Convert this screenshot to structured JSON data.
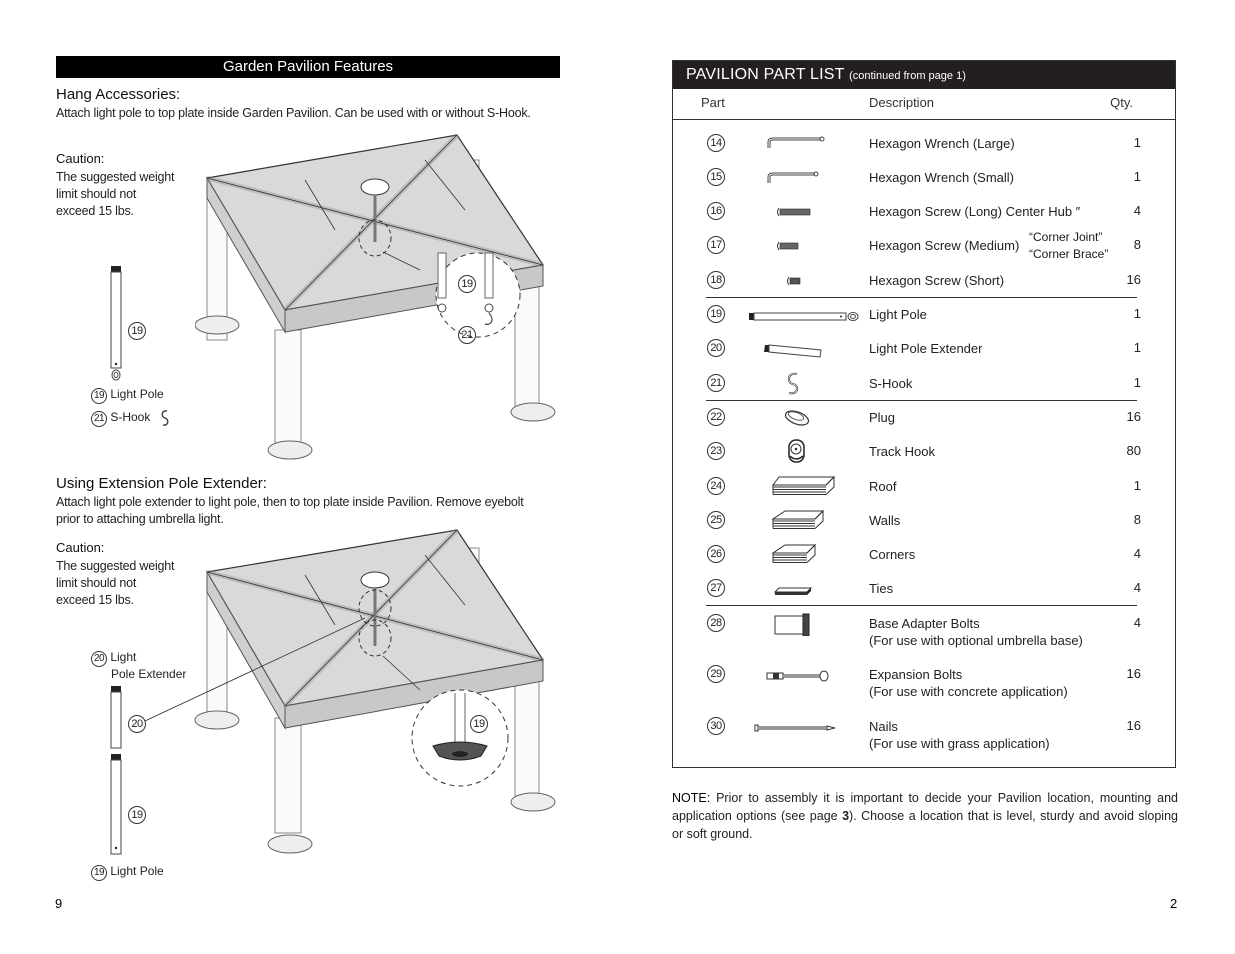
{
  "left_page": {
    "banner": "Garden Pavilion Features",
    "section1": {
      "heading": "Hang Accessories:",
      "body": "Attach light pole to top plate inside Garden Pavilion. Can be used with or without S-Hook.",
      "caution_title": "Caution:",
      "caution_lines": [
        "The suggested weight",
        "limit should not",
        "exceed 15 lbs."
      ],
      "legend": [
        {
          "num": "19",
          "label": "Light Pole"
        },
        {
          "num": "21",
          "label": "S-Hook"
        }
      ],
      "callouts": [
        "19",
        "19",
        "21"
      ]
    },
    "section2": {
      "heading": "Using Extension Pole Extender:",
      "body": "Attach light pole extender to light pole, then to top plate inside Pavilion. Remove eyebolt prior to attaching umbrella light.",
      "caution_title": "Caution:",
      "caution_lines": [
        "The suggested weight",
        "limit should not",
        "exceed 15 lbs."
      ],
      "legend_top": {
        "num": "20",
        "label_line1": "Light",
        "label_line2": "Pole Extender"
      },
      "legend_bottom": {
        "num": "19",
        "label": "Light Pole"
      },
      "callouts": [
        "20",
        "19",
        "19"
      ]
    },
    "page_number": "9"
  },
  "right_page": {
    "title": "PAVILION PART LIST",
    "subtitle": "(continued from page 1)",
    "columns": {
      "part": "Part",
      "description": "Description",
      "qty": "Qty."
    },
    "parts": [
      {
        "num": "14",
        "icon": "hex-wrench-large-icon",
        "desc": "Hexagon Wrench (Large)",
        "qty": "1"
      },
      {
        "num": "15",
        "icon": "hex-wrench-small-icon",
        "desc": "Hexagon Wrench (Small)",
        "qty": "1"
      },
      {
        "num": "16",
        "icon": "hex-screw-long-icon",
        "desc": "Hexagon Screw (Long) Center Hub ″",
        "qty": "4"
      },
      {
        "num": "17",
        "icon": "hex-screw-medium-icon",
        "desc": "Hexagon Screw (Medium)",
        "note1": "“Corner Joint”",
        "note2": "“Corner Brace”",
        "qty": "8"
      },
      {
        "num": "18",
        "icon": "hex-screw-short-icon",
        "desc": "Hexagon Screw (Short)",
        "qty": "16"
      },
      {
        "num": "19",
        "icon": "light-pole-icon",
        "desc": "Light Pole",
        "qty": "1"
      },
      {
        "num": "20",
        "icon": "light-pole-extender-icon",
        "desc": "Light Pole Extender",
        "qty": "1"
      },
      {
        "num": "21",
        "icon": "s-hook-icon",
        "desc": "S-Hook",
        "qty": "1"
      },
      {
        "num": "22",
        "icon": "plug-icon",
        "desc": "Plug",
        "qty": "16"
      },
      {
        "num": "23",
        "icon": "track-hook-icon",
        "desc": "Track Hook",
        "qty": "80"
      },
      {
        "num": "24",
        "icon": "roof-panels-icon",
        "desc": "Roof",
        "qty": "1"
      },
      {
        "num": "25",
        "icon": "wall-panels-icon",
        "desc": "Walls",
        "qty": "8"
      },
      {
        "num": "26",
        "icon": "corner-panels-icon",
        "desc": "Corners",
        "qty": "4"
      },
      {
        "num": "27",
        "icon": "ties-icon",
        "desc": "Ties",
        "qty": "4"
      },
      {
        "num": "28",
        "icon": "base-adapter-bolt-icon",
        "desc": "Base Adapter Bolts",
        "desc2": "(For use with optional umbrella base)",
        "qty": "4"
      },
      {
        "num": "29",
        "icon": "expansion-bolt-icon",
        "desc": "Expansion Bolts",
        "desc2": "(For use with concrete application)",
        "qty": "16"
      },
      {
        "num": "30",
        "icon": "nail-icon",
        "desc": "Nails",
        "desc2": "(For use with grass application)",
        "qty": "16"
      }
    ],
    "note": {
      "label": "NOTE:",
      "text_before": " Prior to assembly it is important to decide your Pavilion location, mounting and application options (see page ",
      "page_ref": "3",
      "text_after": ").  Choose a location that is level, sturdy and avoid sloping or soft ground."
    },
    "page_number": "2"
  }
}
